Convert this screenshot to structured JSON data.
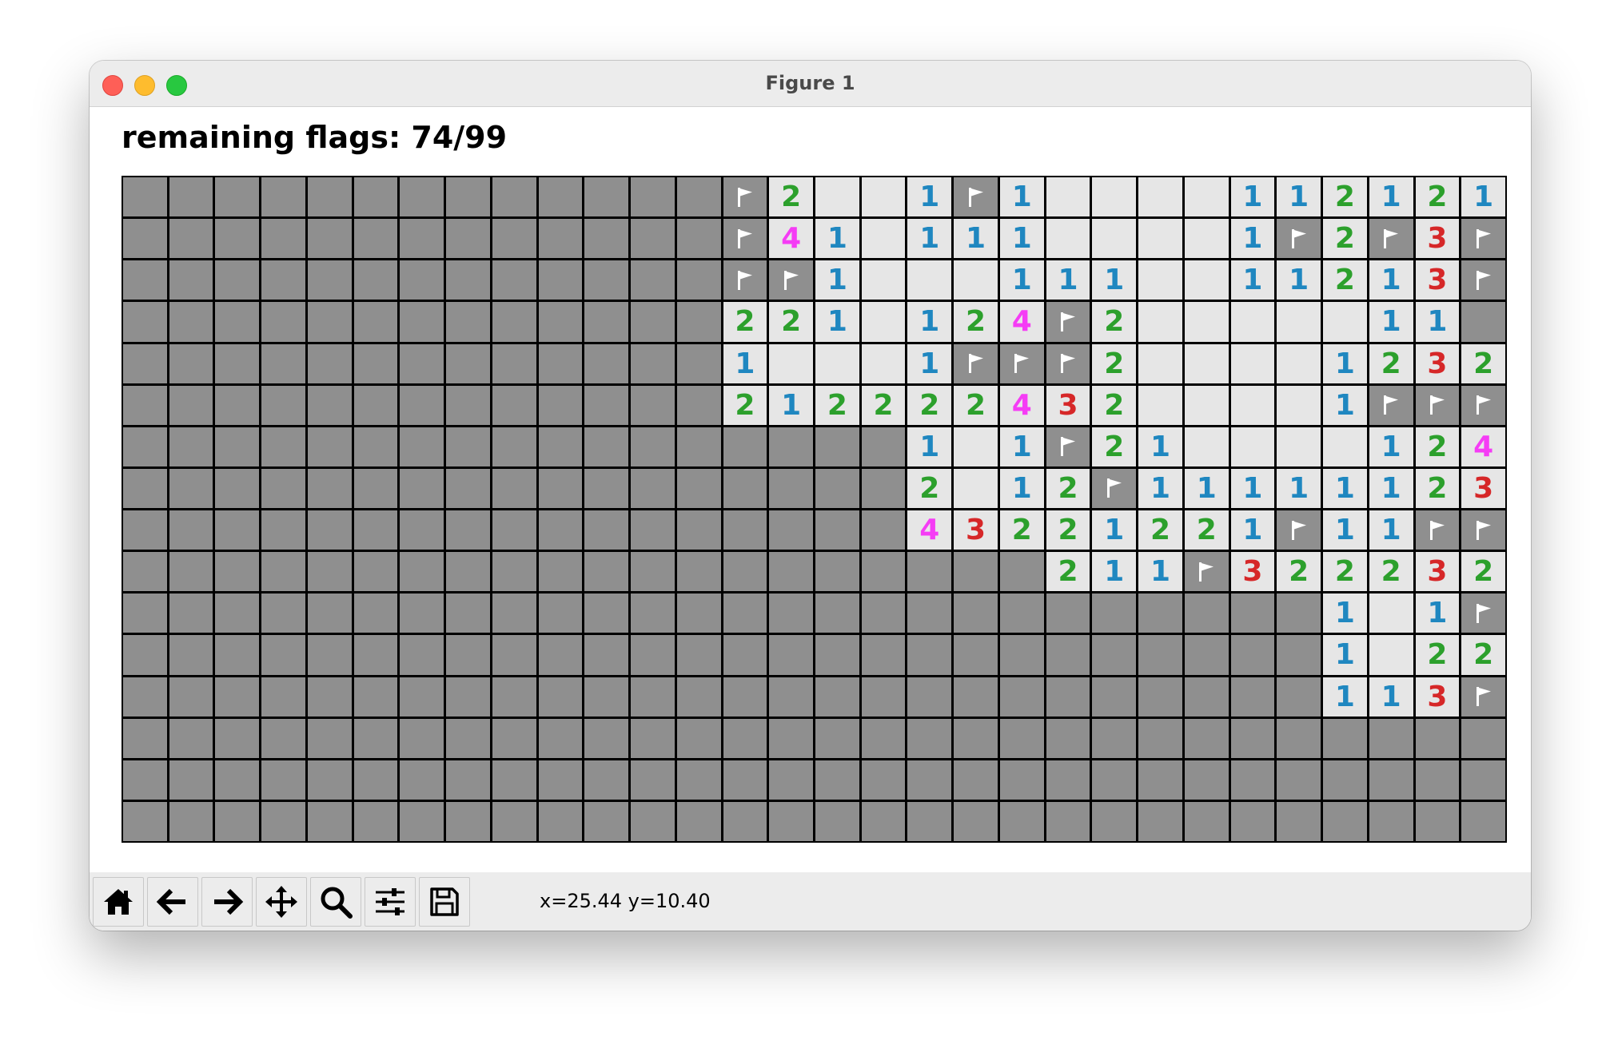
{
  "window": {
    "title": "Figure 1"
  },
  "status": {
    "title": "remaining flags: 74/99"
  },
  "toolbar": {
    "buttons": [
      {
        "id": "home",
        "icon": "home-icon"
      },
      {
        "id": "back",
        "icon": "arrow-left-icon"
      },
      {
        "id": "forward",
        "icon": "arrow-right-icon"
      },
      {
        "id": "pan",
        "icon": "move-icon"
      },
      {
        "id": "zoom",
        "icon": "zoom-icon"
      },
      {
        "id": "configure",
        "icon": "sliders-icon"
      },
      {
        "id": "save",
        "icon": "save-icon"
      }
    ],
    "coords": "x=25.44 y=10.40"
  },
  "colors": {
    "hidden": "#8f8f8f",
    "revealed": "#e6e6e6",
    "1": "#1f87c0",
    "2": "#2ca02c",
    "3": "#d62728",
    "4": "#f53cf5"
  },
  "board": {
    "cols": 30,
    "rows": 16,
    "legend": "#=hidden, F=flag, .=empty revealed, 1-8=number",
    "grid": [
      "#############F2..1F1....11212 1",
      "#############F41.111....1F2F3F",
      "#############FF1...111..11213F",
      "#############221.124F2.....11",
      "#############1...1FFF2....1232",
      "#############21222243 2....1FFF",
      "#################1.1F21....1243",
      "#################2.12F11111123F",
      "#################43221221F11FF2",
      "####################211F322232",
      "##########################1.1F",
      "##########################1.22",
      "##########################113F",
      "##############################",
      "##############################",
      "##############################"
    ]
  }
}
